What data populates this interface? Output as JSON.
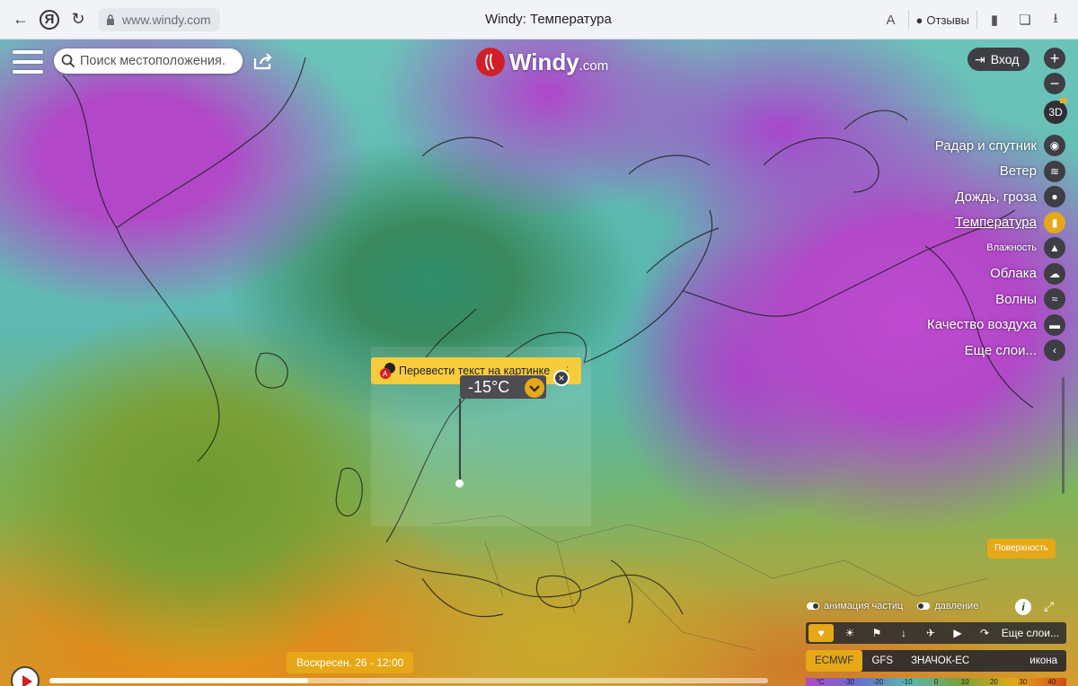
{
  "browser": {
    "url": "www.windy.com",
    "title": "Windy: Температура",
    "feedback_label": "Отзывы"
  },
  "app": {
    "search_placeholder": "Поиск местоположения.",
    "logo_name": "Windy",
    "logo_domain": ".com",
    "login_label": "Вход",
    "zoom_in": "+",
    "zoom_out": "−",
    "btn_3d": "3D"
  },
  "layers": [
    {
      "label": "Радар и спутник",
      "icon": "globe-icon",
      "glyph": "◉",
      "active": false,
      "small": false
    },
    {
      "label": "Ветер",
      "icon": "wind-icon",
      "glyph": "≋",
      "active": false,
      "small": false
    },
    {
      "label": "Дождь, гроза",
      "icon": "raindrop-icon",
      "glyph": "●",
      "active": false,
      "small": false
    },
    {
      "label": "Температура",
      "icon": "thermometer-icon",
      "glyph": "▮",
      "active": true,
      "small": false
    },
    {
      "label": "Влажность",
      "icon": "humidity-icon",
      "glyph": "▲",
      "active": false,
      "small": true
    },
    {
      "label": "Облака",
      "icon": "cloud-icon",
      "glyph": "☁",
      "active": false,
      "small": false
    },
    {
      "label": "Волны",
      "icon": "waves-icon",
      "glyph": "≈",
      "active": false,
      "small": false
    },
    {
      "label": "Качество воздуха",
      "icon": "car-icon",
      "glyph": "▬",
      "active": false,
      "small": false
    },
    {
      "label": "Еще слои...",
      "icon": "chevron-left-icon",
      "glyph": "‹",
      "active": false,
      "small": false
    }
  ],
  "popup": {
    "translate_label": "Перевести текст на картинке",
    "temperature": "-15°C",
    "close": "×"
  },
  "surface_label": "Поверхность",
  "toggles": {
    "particles": "анимация частиц",
    "pressure": "давление"
  },
  "info_label": "i",
  "fav_more": "Еще слои...",
  "models": [
    {
      "label": "ECMWF",
      "active": true
    },
    {
      "label": "GFS",
      "active": false
    },
    {
      "label": "ЗНАЧОК-ЕС",
      "active": false
    },
    {
      "label": "икона",
      "active": false
    }
  ],
  "scale_labels": [
    "°C",
    "-30",
    "-20",
    "-10",
    "0",
    "10",
    "20",
    "30",
    "40"
  ],
  "time_label": "Воскресен. 26 - 12:00",
  "timeline_progress": 0.36,
  "colors": {
    "accent": "#e6a817",
    "dark_button": "#3e3e44",
    "logo_red": "#d21f26"
  }
}
